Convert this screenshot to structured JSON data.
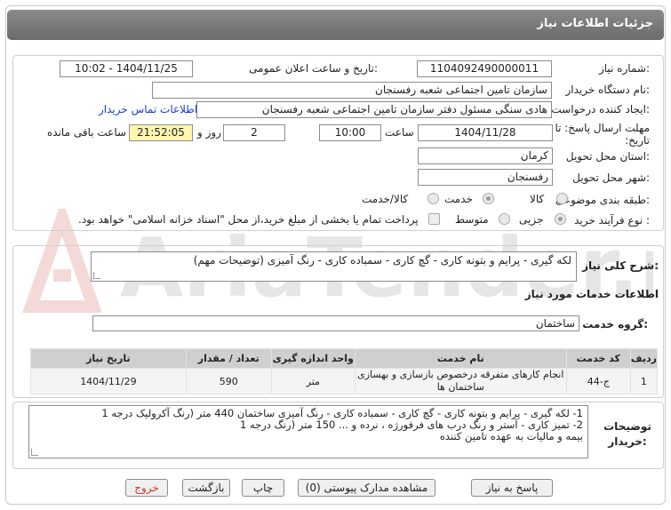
{
  "header": {
    "title": "جزئیات اطلاعات نیاز"
  },
  "watermark_text": "AriaTender.net",
  "fields": {
    "need_number_label": "شماره نیاز:",
    "need_number": "1104092490000011",
    "announce_label": "تاریخ و ساعت اعلان عمومی:",
    "announce_value": "1404/11/25 - 10:02",
    "buyer_label": "نام دستگاه خریدار:",
    "buyer_value": "سازمان تامین اجتماعی شعبه رفسنجان",
    "creator_label": "ایجاد کننده درخواست:",
    "creator_value": "هادی سنگی مسئول دفتر سازمان تامین اجتماعی شعبه رفسنجان",
    "contact_link": "اطلاعات تماس خریدار",
    "deadline_label": "مهلت ارسال پاسخ: تا تاریخ:",
    "deadline_date": "1404/11/28",
    "time_label": "ساعت",
    "deadline_time": "10:00",
    "days_value": "2",
    "days_label": "روز و",
    "remaining_time": "21:52:05",
    "remaining_label": "ساعت باقی مانده",
    "province_label": "استان محل تحویل:",
    "province_value": "کرمان",
    "city_label": "شهر محل تحویل:",
    "city_value": "رفسنجان",
    "category_label": "طبقه بندی موضوعی:",
    "category_options": [
      "کالا",
      "خدمت",
      "کالا/خدمت"
    ],
    "process_label": "نوع فرآیند خرید :",
    "process_options": [
      "جزیی",
      "متوسط"
    ],
    "payment_note": "پرداخت تمام یا بخشی از مبلغ خرید،از محل \"اسناد خزانه اسلامی\" خواهد بود."
  },
  "summary": {
    "label": "شرح کلی نیاز:",
    "value": "لکه گیری - پرایم و بتونه کاری - گچ کاری - سمباده کاری - رنگ آمیزی (توضیحات مهم)"
  },
  "services": {
    "section_title": "اطلاعات خدمات مورد نیاز",
    "group_label": "گروه خدمت:",
    "group_value": "ساختمان",
    "columns": [
      "ردیف",
      "کد خدمت",
      "نام خدمت",
      "واحد اندازه گیری",
      "تعداد / مقدار",
      "تاریخ نیاز"
    ],
    "rows": [
      [
        "1",
        "ج-44",
        "انجام کارهای متفرقه درخصوص بازسازی و بهسازی ساختمان ها",
        "متر",
        "590",
        "1404/11/29"
      ]
    ]
  },
  "description": {
    "label": "توضیحات خریدار:",
    "lines": [
      "1- لکه گیری - پرایم و بتونه کاری - گچ کاری - سمباده کاری - رنگ آمیزی ساختمان 440 متر (رنگ آکرولیک درجه 1",
      "2- تمیز کاری - آستر و رنگ درب های فرفورژه ، نرده و ... 150 متر (رنگ درجه 1",
      "بیمه و مالیات به عهده تامین کننده"
    ]
  },
  "buttons": {
    "reply": "پاسخ به نیاز",
    "attachments": "مشاهده مدارک پیوستی (0)",
    "print": "چاپ",
    "back": "بازگشت",
    "exit": "خروج"
  }
}
